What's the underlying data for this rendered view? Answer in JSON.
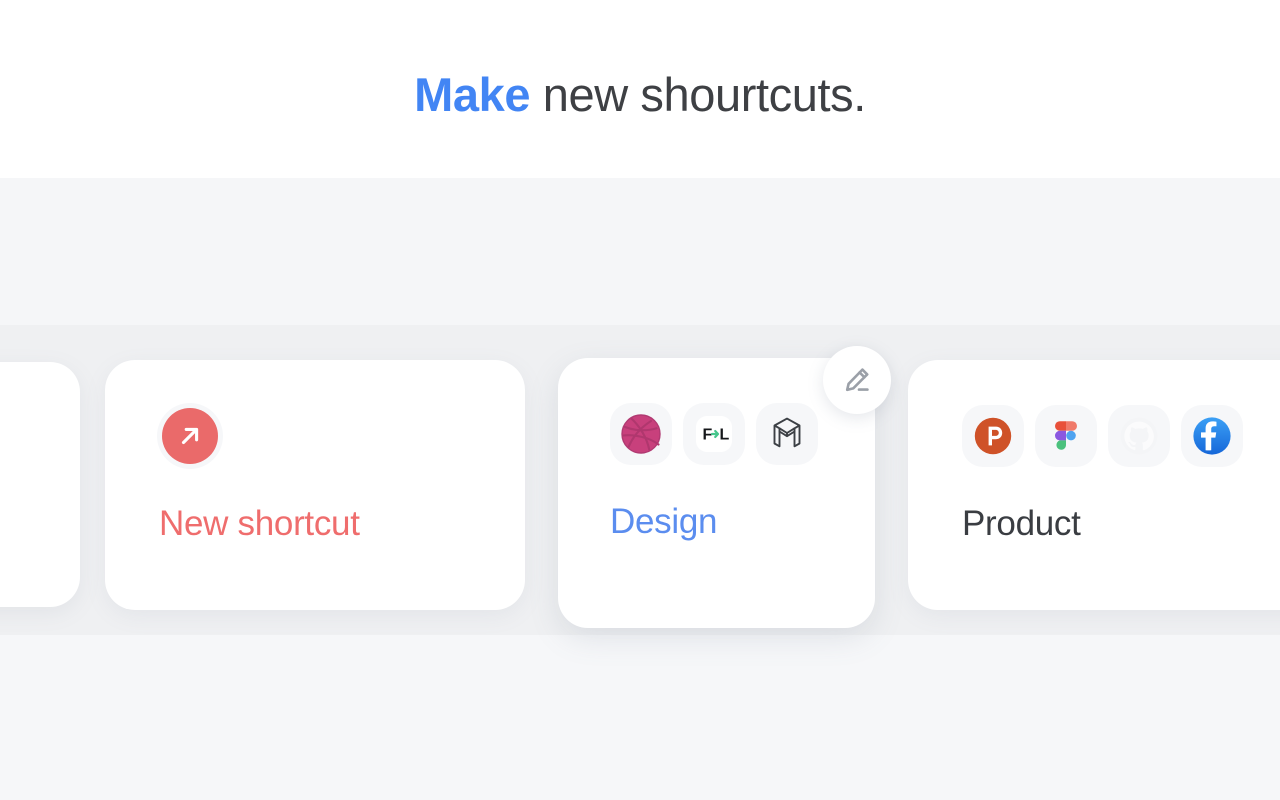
{
  "page": {
    "headline_accent": "Make",
    "headline_rest": " new shourtcuts.",
    "background": "#f6f7f9",
    "strip_background": "#eff0f2"
  },
  "colors": {
    "accent_blue": "#4285f4",
    "design_blue": "#5b8def",
    "coral_red": "#ea6a6a",
    "title_dark": "#3a3d42",
    "tile_gray": "#f6f7f9"
  },
  "carousel": {
    "cards": [
      {
        "id": "ghost",
        "name": "",
        "title_color": "",
        "icons": []
      },
      {
        "id": "new-shortcut",
        "name": "New shortcut",
        "title_color": "#ef6d6d",
        "icons": [
          {
            "name": "arrow-up-right-icon",
            "label": "New shortcut arrow"
          }
        ]
      },
      {
        "id": "design",
        "name": "Design",
        "title_color": "#5b8def",
        "selected": true,
        "icons": [
          {
            "name": "dribbble-icon",
            "label": "Dribbble"
          },
          {
            "name": "figma-to-lottie-icon",
            "label": "F L"
          },
          {
            "name": "m-logo-icon",
            "label": "M"
          }
        ]
      },
      {
        "id": "product",
        "name": "Product",
        "title_color": "#3a3d42",
        "icons": [
          {
            "name": "product-hunt-icon",
            "label": "Product Hunt"
          },
          {
            "name": "figma-icon",
            "label": "Figma"
          },
          {
            "name": "github-icon",
            "label": "GitHub"
          },
          {
            "name": "facebook-icon",
            "label": "Facebook"
          }
        ]
      }
    ],
    "edit_button": {
      "name": "edit-shortcut-button",
      "icon": "pencil-edit-icon"
    }
  }
}
